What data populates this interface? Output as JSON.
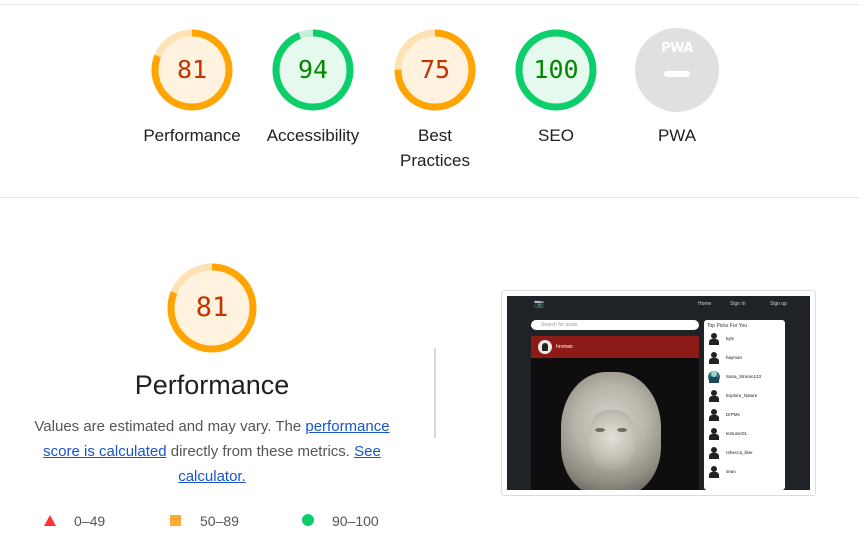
{
  "categories": [
    {
      "score": "81",
      "label": "Performance",
      "level": "average",
      "fraction": 0.81
    },
    {
      "score": "94",
      "label": "Accessibility",
      "level": "pass",
      "fraction": 0.94
    },
    {
      "score": "75",
      "label": "Best Practices",
      "level": "average",
      "fraction": 0.75
    },
    {
      "score": "100",
      "label": "SEO",
      "level": "pass",
      "fraction": 1.0
    },
    {
      "score": "",
      "label": "PWA",
      "level": "na",
      "fraction": 0
    }
  ],
  "pwa_badge": "PWA",
  "performance": {
    "score": "81",
    "fraction": 0.81,
    "title": "Performance",
    "desc_part1": "Values are estimated and may vary. The ",
    "desc_link1": "performance score is calculated",
    "desc_part2": " directly from these metrics. ",
    "desc_link2": "See calculator."
  },
  "legend": {
    "fail": "0–49",
    "average": "50–89",
    "pass": "90–100"
  },
  "colors": {
    "average_stroke": "#ffa400",
    "average_fill": "#fff3e0",
    "average_text": "#c33300",
    "pass_stroke": "#0cce6b",
    "pass_fill": "#e6f9ee",
    "pass_text": "#008800",
    "na_fill": "#e0e0e0",
    "link": "#1a55cc"
  },
  "thumbnail": {
    "nav_links": [
      "Home",
      "Sign In",
      "Sign up"
    ],
    "search_placeholder": "Search for posts",
    "post_user": "hrvman",
    "side_title": "Top Picks For You",
    "side_users": [
      "kyle",
      "hayman",
      "Sana_Stream123",
      "Explore_Nature",
      "DrPMs",
      "testuser01",
      "rebecca_liker",
      "sean"
    ]
  }
}
